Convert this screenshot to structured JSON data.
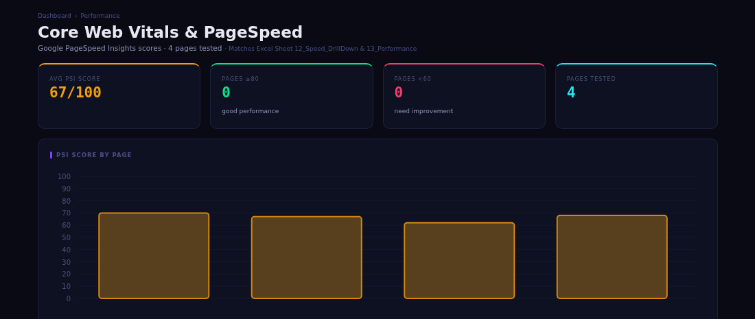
{
  "breadcrumb": {
    "items": [
      "Dashboard",
      "Performance"
    ],
    "separator": "›"
  },
  "title": "Core Web Vitals & PageSpeed",
  "subtitle": {
    "main": "Google PageSpeed Insights scores · 4 pages tested",
    "note": "· Matches Excel Sheet 12_Speed_DrillDown & 13_Performance"
  },
  "stats": [
    {
      "label": "AVG PSI SCORE",
      "value": "67/100",
      "color": "#f59e0b"
    },
    {
      "label": "PAGES ≥80",
      "value": "0",
      "caption": "good performance",
      "color": "#10e08a"
    },
    {
      "label": "PAGES <60",
      "value": "0",
      "caption": "need improvement",
      "color": "#f43f6e"
    },
    {
      "label": "PAGES TESTED",
      "value": "4",
      "color": "#22e5f0"
    }
  ],
  "chart_panel": {
    "title": "PSI SCORE BY PAGE",
    "chart_data": {
      "type": "bar",
      "values": [
        70,
        67,
        62,
        68
      ],
      "ylim": [
        0,
        100
      ],
      "grid": true,
      "yticks": [
        0,
        10,
        20,
        30,
        40,
        50,
        60,
        70,
        80,
        90,
        100
      ]
    }
  }
}
